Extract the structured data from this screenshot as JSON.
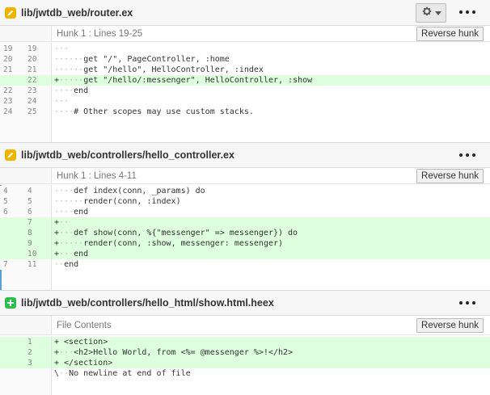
{
  "files": [
    {
      "path": "lib/jwtdb_web/router.ex",
      "status": "modified",
      "hunk_label": "Hunk 1 : Lines 19-25",
      "reverse_label": "Reverse hunk",
      "lines": [
        {
          "old": "19",
          "new": "19",
          "type": "ctx",
          "text": "···"
        },
        {
          "old": "20",
          "new": "20",
          "type": "ctx",
          "text": "······get \"/\", PageController, :home"
        },
        {
          "old": "21",
          "new": "21",
          "type": "ctx",
          "text": "······get \"/hello\", HelloController, :index"
        },
        {
          "old": "",
          "new": "22",
          "type": "add",
          "text": "+·····get \"/hello/:messenger\", HelloController, :show"
        },
        {
          "old": "22",
          "new": "23",
          "type": "ctx",
          "text": "····end"
        },
        {
          "old": "23",
          "new": "24",
          "type": "ctx",
          "text": "···"
        },
        {
          "old": "24",
          "new": "25",
          "type": "ctx",
          "text": "····# Other scopes may use custom stacks."
        }
      ]
    },
    {
      "path": "lib/jwtdb_web/controllers/hello_controller.ex",
      "status": "modified",
      "hunk_label": "Hunk 1 : Lines 4-11",
      "reverse_label": "Reverse hunk",
      "lines": [
        {
          "old": "4",
          "new": "4",
          "type": "ctx",
          "text": "····def index(conn, _params) do"
        },
        {
          "old": "5",
          "new": "5",
          "type": "ctx",
          "text": "······render(conn, :index)"
        },
        {
          "old": "6",
          "new": "6",
          "type": "ctx",
          "text": "····end"
        },
        {
          "old": "",
          "new": "7",
          "type": "add",
          "text": "+··"
        },
        {
          "old": "",
          "new": "8",
          "type": "add",
          "text": "+···def show(conn, %{\"messenger\" => messenger}) do"
        },
        {
          "old": "",
          "new": "9",
          "type": "add",
          "text": "+·····render(conn, :show, messenger: messenger)"
        },
        {
          "old": "",
          "new": "10",
          "type": "add",
          "text": "+···end"
        },
        {
          "old": "7",
          "new": "11",
          "type": "ctx",
          "text": "··end"
        }
      ]
    },
    {
      "path": "lib/jwtdb_web/controllers/hello_html/show.html.heex",
      "status": "added",
      "hunk_label": "File Contents",
      "reverse_label": "Reverse hunk",
      "lines": [
        {
          "old": "",
          "new": "1",
          "type": "add",
          "text": "+ <section>"
        },
        {
          "old": "",
          "new": "2",
          "type": "add",
          "text": "+···<h2>Hello World, from <%= @messenger %>!</h2>"
        },
        {
          "old": "",
          "new": "3",
          "type": "add",
          "text": "+ </section>"
        },
        {
          "old": "",
          "new": "",
          "type": "ctx",
          "text": "\\··No newline at end of file"
        }
      ]
    }
  ],
  "icons": {
    "gear": "gear-icon",
    "dropdown": "chevron-down-icon",
    "more": "more-horizontal-icon",
    "modified": "pencil-icon",
    "added": "plus-icon"
  },
  "colors": {
    "added_bg": "#ddffdd",
    "modified_badge": "#f0b400",
    "added_badge": "#2cbe4e"
  }
}
